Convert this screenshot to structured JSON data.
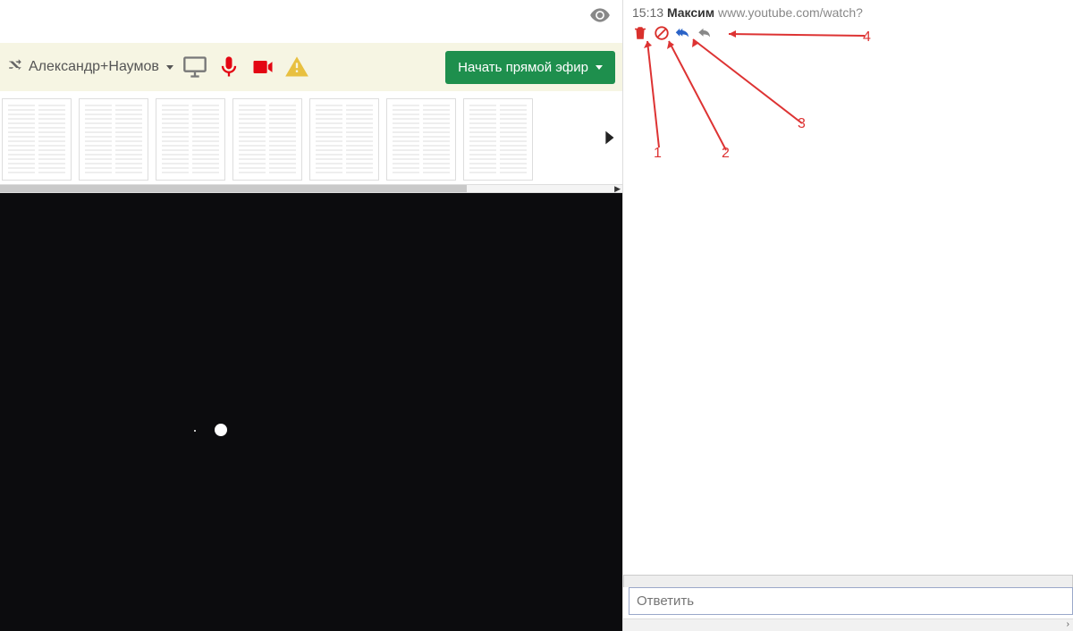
{
  "toolbar": {
    "user_label": "Александр+Наумов",
    "start_label": "Начать прямой эфир"
  },
  "icons": {
    "eye": "eye-icon",
    "shuffle": "shuffle-icon",
    "monitor": "monitor-icon",
    "mic": "mic-icon",
    "camera": "camera-icon",
    "warning": "warning-icon",
    "next": "chevron-right-icon",
    "trash": "trash-icon",
    "block": "block-icon",
    "reply_all": "reply-all-icon",
    "reply": "reply-icon"
  },
  "thumbs": {
    "count": 7
  },
  "chat": {
    "message": {
      "time": "15:13",
      "name": "Максим",
      "url": "www.youtube.com/watch?"
    },
    "reply_placeholder": "Ответить"
  },
  "annotations": {
    "n1": "1",
    "n2": "2",
    "n3": "3",
    "n4": "4"
  },
  "colors": {
    "accent_green": "#1e8f4d",
    "danger_red": "#d9302c",
    "icon_red": "#e30613",
    "link_blue": "#2962c7",
    "anno_red": "#d33"
  }
}
